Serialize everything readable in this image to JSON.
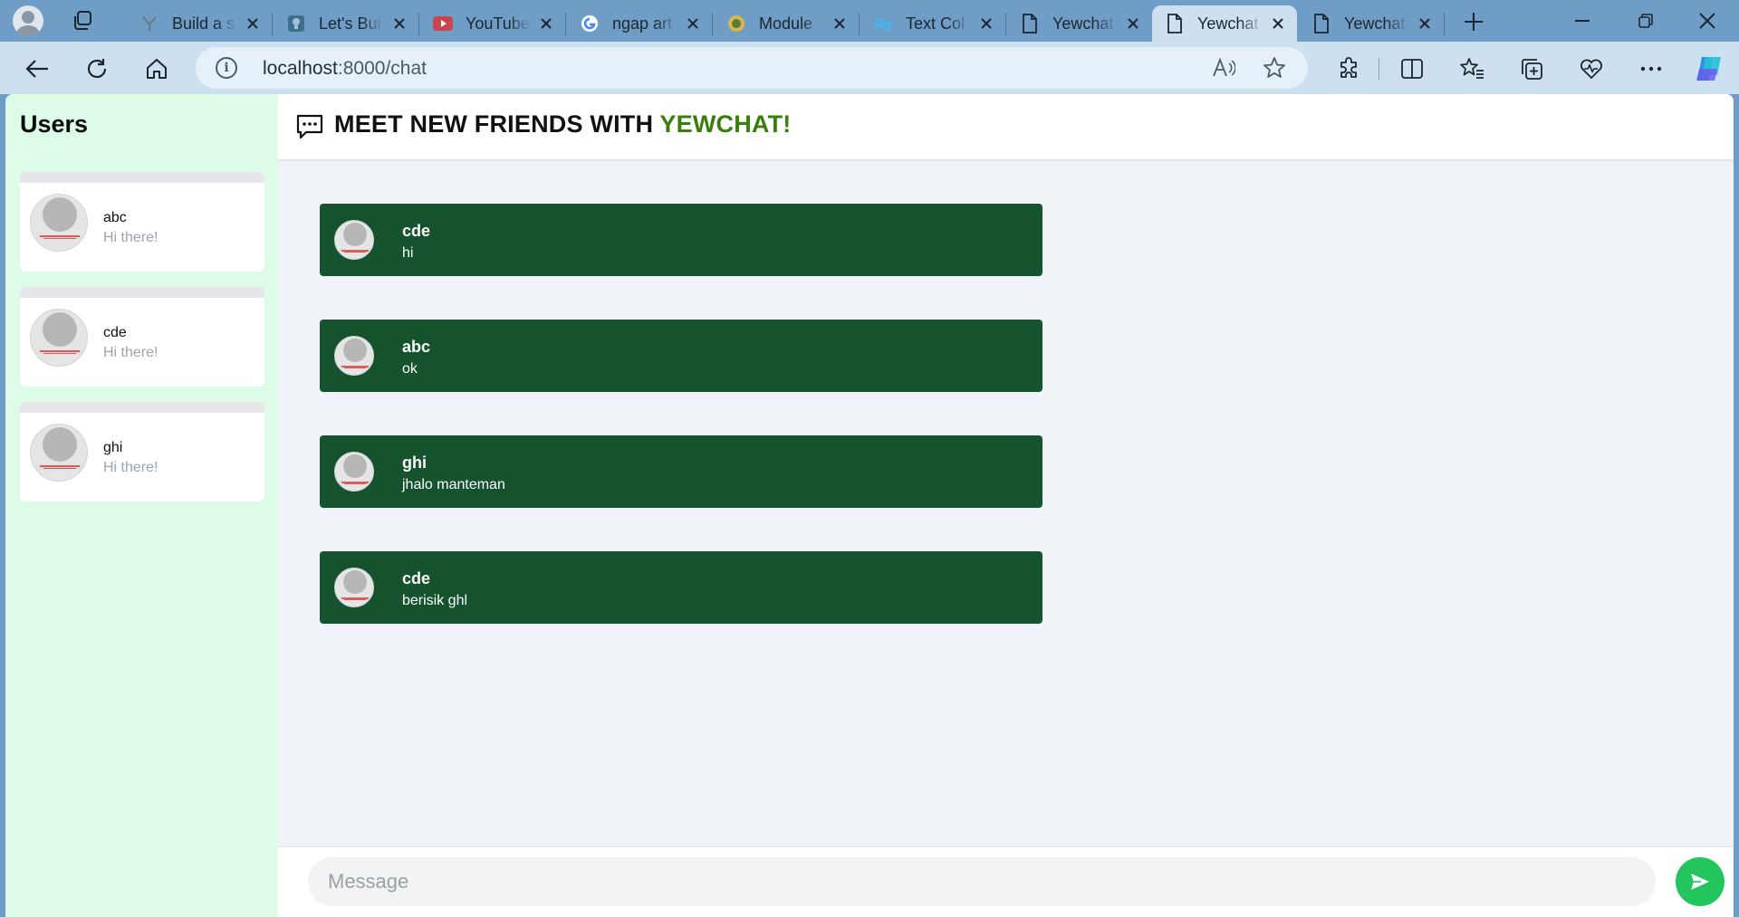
{
  "browser": {
    "tabs": [
      {
        "title": "Build a s",
        "favicon": "y-logo-icon"
      },
      {
        "title": "Let's Bui",
        "favicon": "lightbulb-icon"
      },
      {
        "title": "YouTube",
        "favicon": "youtube-icon"
      },
      {
        "title": "ngap art",
        "favicon": "google-icon"
      },
      {
        "title": "Module",
        "favicon": "module-logo-icon"
      },
      {
        "title": "Text Col",
        "favicon": "tailwind-icon"
      },
      {
        "title": "Yewchat",
        "favicon": "page-icon"
      },
      {
        "title": "Yewchat",
        "favicon": "page-icon",
        "active": true
      },
      {
        "title": "Yewchat",
        "favicon": "page-icon"
      }
    ],
    "address": {
      "host": "localhost",
      "path": ":8000/chat"
    }
  },
  "sidebar": {
    "title": "Users",
    "users": [
      {
        "name": "abc",
        "status": "Hi there!"
      },
      {
        "name": "cde",
        "status": "Hi there!"
      },
      {
        "name": "ghi",
        "status": "Hi there!"
      }
    ]
  },
  "chat": {
    "header_prefix": "MEET NEW FRIENDS WITH ",
    "header_brand": "YEWCHAT!",
    "messages": [
      {
        "from": "cde",
        "text": "hi"
      },
      {
        "from": "abc",
        "text": "ok"
      },
      {
        "from": "ghi",
        "text": "jhalo manteman"
      },
      {
        "from": "cde",
        "text": "berisik ghl"
      }
    ],
    "composer": {
      "placeholder": "Message"
    }
  },
  "colors": {
    "sidebar_bg": "#dcfce7",
    "message_bg": "#14532d",
    "brand_green": "#3b7d0f",
    "send_button": "#22c55e",
    "browser_frame": "#6f9dc6"
  }
}
